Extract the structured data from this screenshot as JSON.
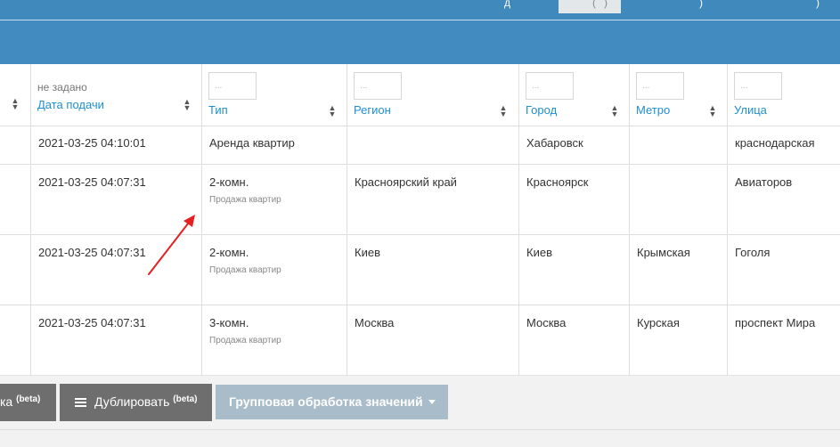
{
  "toolbar": {
    "edit_label_partial": "ка",
    "beta": "(beta)",
    "duplicate_label": "Дублировать",
    "batch_label": "Групповая обработка значений",
    "icon_duplicate": "grid-icon",
    "icon_caret": "caret-down-icon"
  },
  "top_nav": {
    "glyphs": [
      "д",
      "(",
      ")",
      ")",
      ")"
    ]
  },
  "table": {
    "filter_placeholder": "...",
    "columns": {
      "date": {
        "hint": "не задано",
        "title": "Дата подачи"
      },
      "type": {
        "title": "Тип"
      },
      "region": {
        "title": "Регион"
      },
      "city": {
        "title": "Город"
      },
      "metro": {
        "title": "Метро"
      },
      "street": {
        "title": "Улица"
      }
    },
    "rows": [
      {
        "date": "2021-03-25 04:10:01",
        "type": "Аренда квартир",
        "type_sub": "",
        "region": "",
        "city": "Хабаровск",
        "metro": "",
        "street": "краснодарская"
      },
      {
        "date": "2021-03-25 04:07:31",
        "type": "2-комн.",
        "type_sub": "Продажа квартир",
        "region": "Красноярский край",
        "city": "Красноярск",
        "metro": "",
        "street": "Авиаторов"
      },
      {
        "date": "2021-03-25 04:07:31",
        "type": "2-комн.",
        "type_sub": "Продажа квартир",
        "region": "Киев",
        "city": "Киев",
        "metro": "Крымская",
        "street": "Гоголя"
      },
      {
        "date": "2021-03-25 04:07:31",
        "type": "3-комн.",
        "type_sub": "Продажа квартир",
        "region": "Москва",
        "city": "Москва",
        "metro": "Курская",
        "street": "проспект Мира"
      }
    ]
  },
  "colors": {
    "header_bar": "#428bc0",
    "link": "#1e8fd0",
    "annotation_arrow": "#e52020",
    "button_dark": "#6e6e6e",
    "button_disabled": "#a9bcc9"
  }
}
